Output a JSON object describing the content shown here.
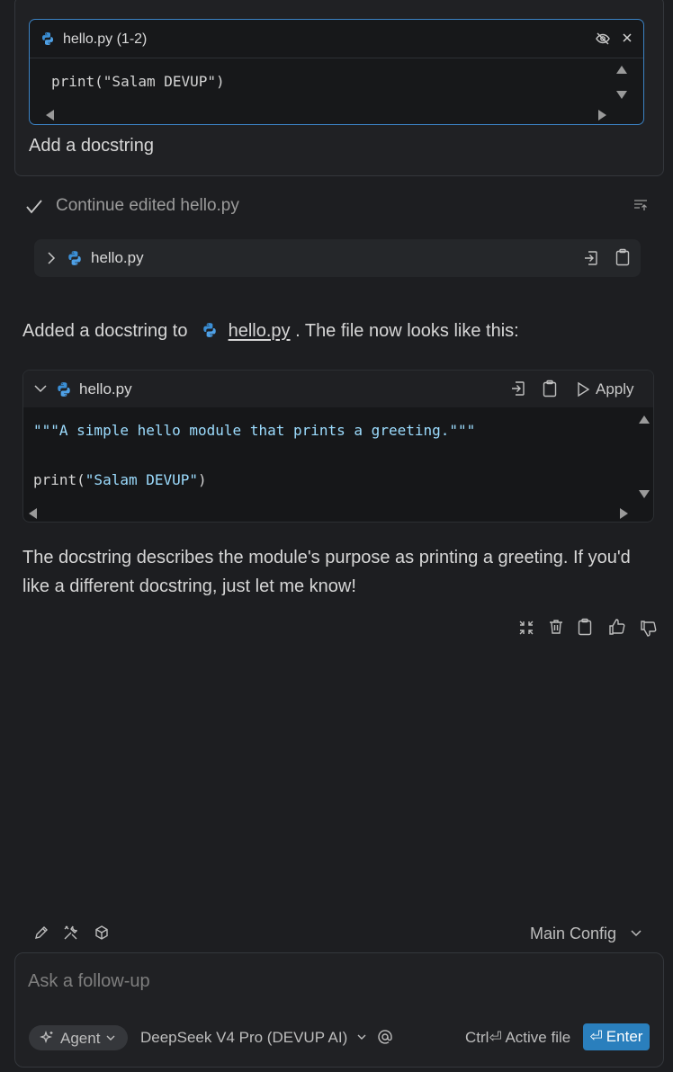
{
  "context_block": {
    "title": "hello.py (1-2)",
    "code": "print(\"Salam DEVUP\")",
    "icons": [
      "python-icon",
      "eye-off-icon",
      "close-icon",
      "scroll-up-arrow",
      "scroll-down-arrow",
      "scroll-left-arrow",
      "scroll-right-arrow"
    ]
  },
  "user_message": "Add a docstring",
  "tool_call": {
    "status": "Continue edited hello.py",
    "file": "hello.py",
    "icons": [
      "check-icon",
      "collapse-all-icon",
      "chevron-right-icon",
      "python-icon",
      "insert-icon",
      "copy-icon"
    ]
  },
  "assistant": {
    "intro_before": "Added a docstring to",
    "intro_link": "hello.py",
    "intro_after": ". The file now looks like this:",
    "code_block": {
      "filename": "hello.py",
      "apply_label": "Apply",
      "lines": [
        {
          "prefix": "",
          "string": "\"\"\"A simple hello module that prints a greeting.\"\"\"",
          "suffix": ""
        },
        {
          "prefix": "",
          "string": "",
          "suffix": ""
        },
        {
          "prefix": "print(",
          "string": "\"Salam DEVUP\"",
          "suffix": ")"
        }
      ]
    },
    "closing": "The docstring describes the module's purpose as printing a greeting. If you'd like a different docstring, just let me know!",
    "action_icons": [
      "compress-icon",
      "trash-icon",
      "copy-icon",
      "thumbs-up-icon",
      "thumbs-down-icon"
    ]
  },
  "toolbar": {
    "icons": [
      "pencil-icon",
      "tools-icon",
      "cube-icon"
    ],
    "config_label": "Main Config"
  },
  "input": {
    "placeholder": "Ask a follow-up",
    "agent_label": "Agent",
    "model_label": "DeepSeek V4 Pro (DEVUP AI)",
    "active_file_label": "Ctrl⏎ Active file",
    "enter_label": "Enter",
    "enter_glyph": "⏎"
  },
  "colors": {
    "background": "#1d1e21",
    "accent": "#2a7fbd",
    "context_border": "#3b82c4",
    "string": "#9cdcfe",
    "python_blue": "#3572a5"
  }
}
